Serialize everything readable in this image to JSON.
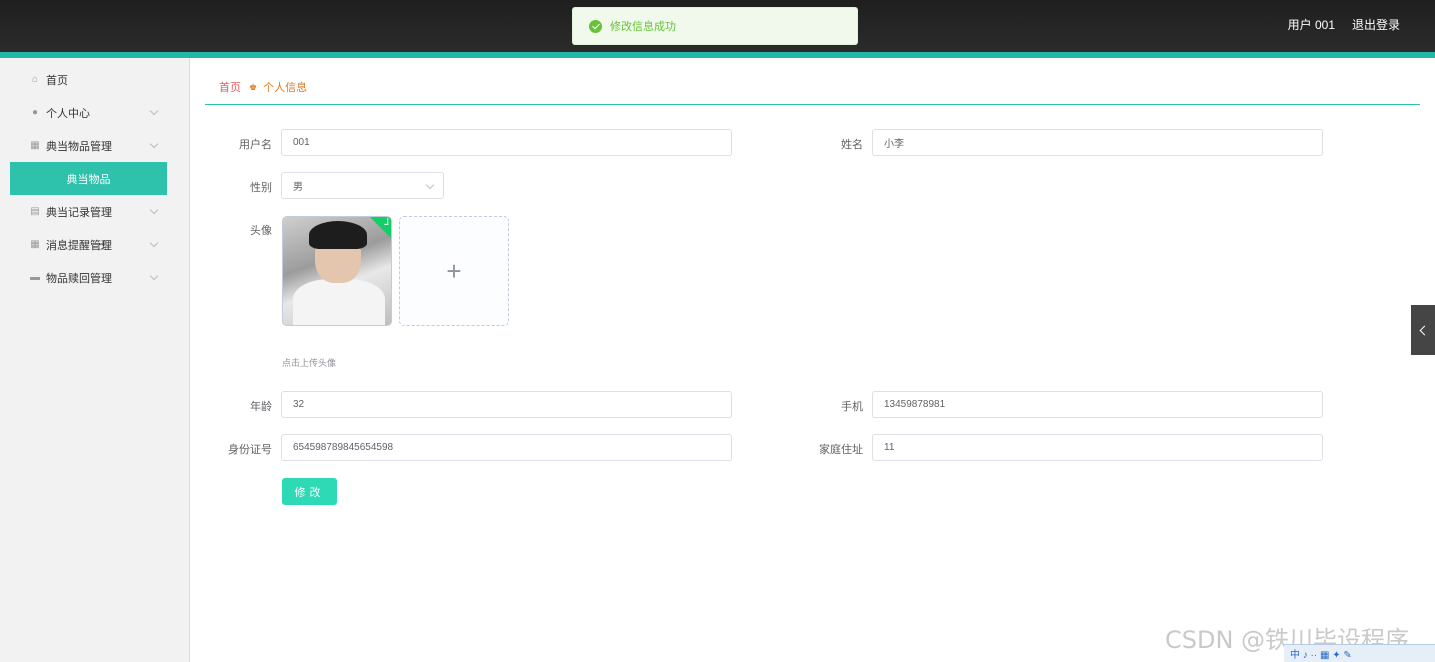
{
  "header": {
    "user_label": "用户 001",
    "logout_label": "退出登录"
  },
  "toast": {
    "message": "修改信息成功",
    "color": "#67c23a"
  },
  "sidebar": {
    "items": [
      {
        "label": "首页",
        "icon": "home-icon"
      },
      {
        "label": "个人中心",
        "icon": "user-icon"
      },
      {
        "label": "典当物品管理",
        "icon": "grid-icon"
      },
      {
        "label": "典当记录管理",
        "icon": "clipboard-icon"
      },
      {
        "label": "消息提醒管理",
        "icon": "grid-icon"
      },
      {
        "label": "物品赎回管理",
        "icon": "briefcase-icon"
      }
    ],
    "active_sub": {
      "label": "典当物品"
    },
    "accent": "#2ec1ac"
  },
  "breadcrumb": {
    "home": "首页",
    "current": "个人信息"
  },
  "form": {
    "username": {
      "label": "用户名",
      "value": "001"
    },
    "name": {
      "label": "姓名",
      "value": "小李"
    },
    "gender": {
      "label": "性别",
      "value": "男"
    },
    "avatar": {
      "label": "头像",
      "tip": "点击上传头像",
      "add_symbol": "+"
    },
    "age": {
      "label": "年龄",
      "value": "32"
    },
    "phone": {
      "label": "手机",
      "value": "13459878981"
    },
    "id_card": {
      "label": "身份证号",
      "value": "654598789845654598"
    },
    "address": {
      "label": "家庭住址",
      "value": "11"
    },
    "submit_label": "修改"
  },
  "watermark": "CSDN @铁川毕设程序",
  "ime_bar": "中 ♪ ·· ▦ ✦ ✎"
}
